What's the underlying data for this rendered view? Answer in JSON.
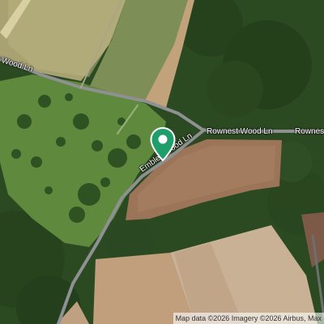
{
  "map": {
    "style": "satellite",
    "roads": {
      "top_road": "st Wood Ln",
      "rownest_main": "Rownest Wood Ln",
      "rownest_partial": "Rownes",
      "embley": "Embley Wood Ln"
    },
    "marker": {
      "icon": "location-pin-icon",
      "color": "#1e9e6a"
    },
    "attribution": "Map data ©2026 Imagery ©2026 Airbus, Max"
  }
}
